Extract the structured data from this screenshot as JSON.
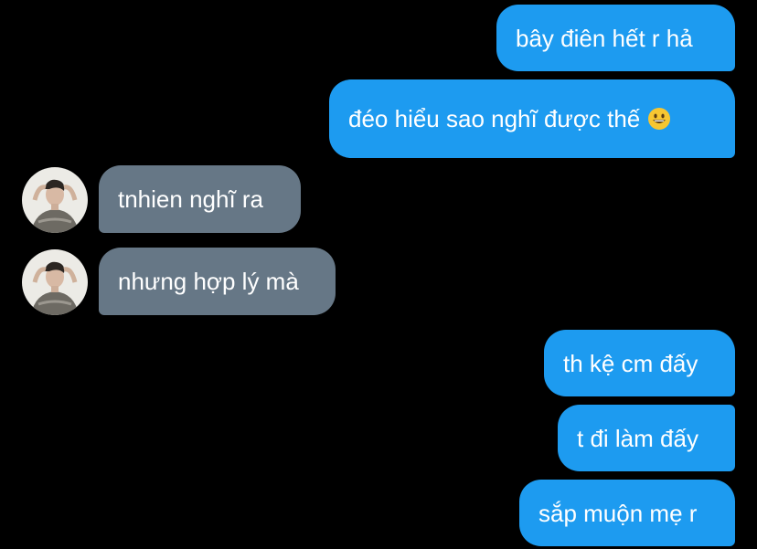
{
  "conversation": {
    "messages": [
      {
        "sender": "me",
        "text": "bây điên hết r hả"
      },
      {
        "sender": "me",
        "text": "đéo hiểu sao nghĩ được thế",
        "emoji": "grinning-face-icon"
      },
      {
        "sender": "them",
        "text": "tnhien nghĩ ra"
      },
      {
        "sender": "them",
        "text": "nhưng hợp lý mà"
      },
      {
        "sender": "me",
        "text": "th kệ cm đấy"
      },
      {
        "sender": "me",
        "text": "t đi làm đấy"
      },
      {
        "sender": "me",
        "text": "sắp muộn mẹ r"
      }
    ]
  },
  "colors": {
    "background": "#000000",
    "outgoing_bubble": "#1d9bf0",
    "incoming_bubble": "#667786",
    "text": "#ffffff"
  }
}
